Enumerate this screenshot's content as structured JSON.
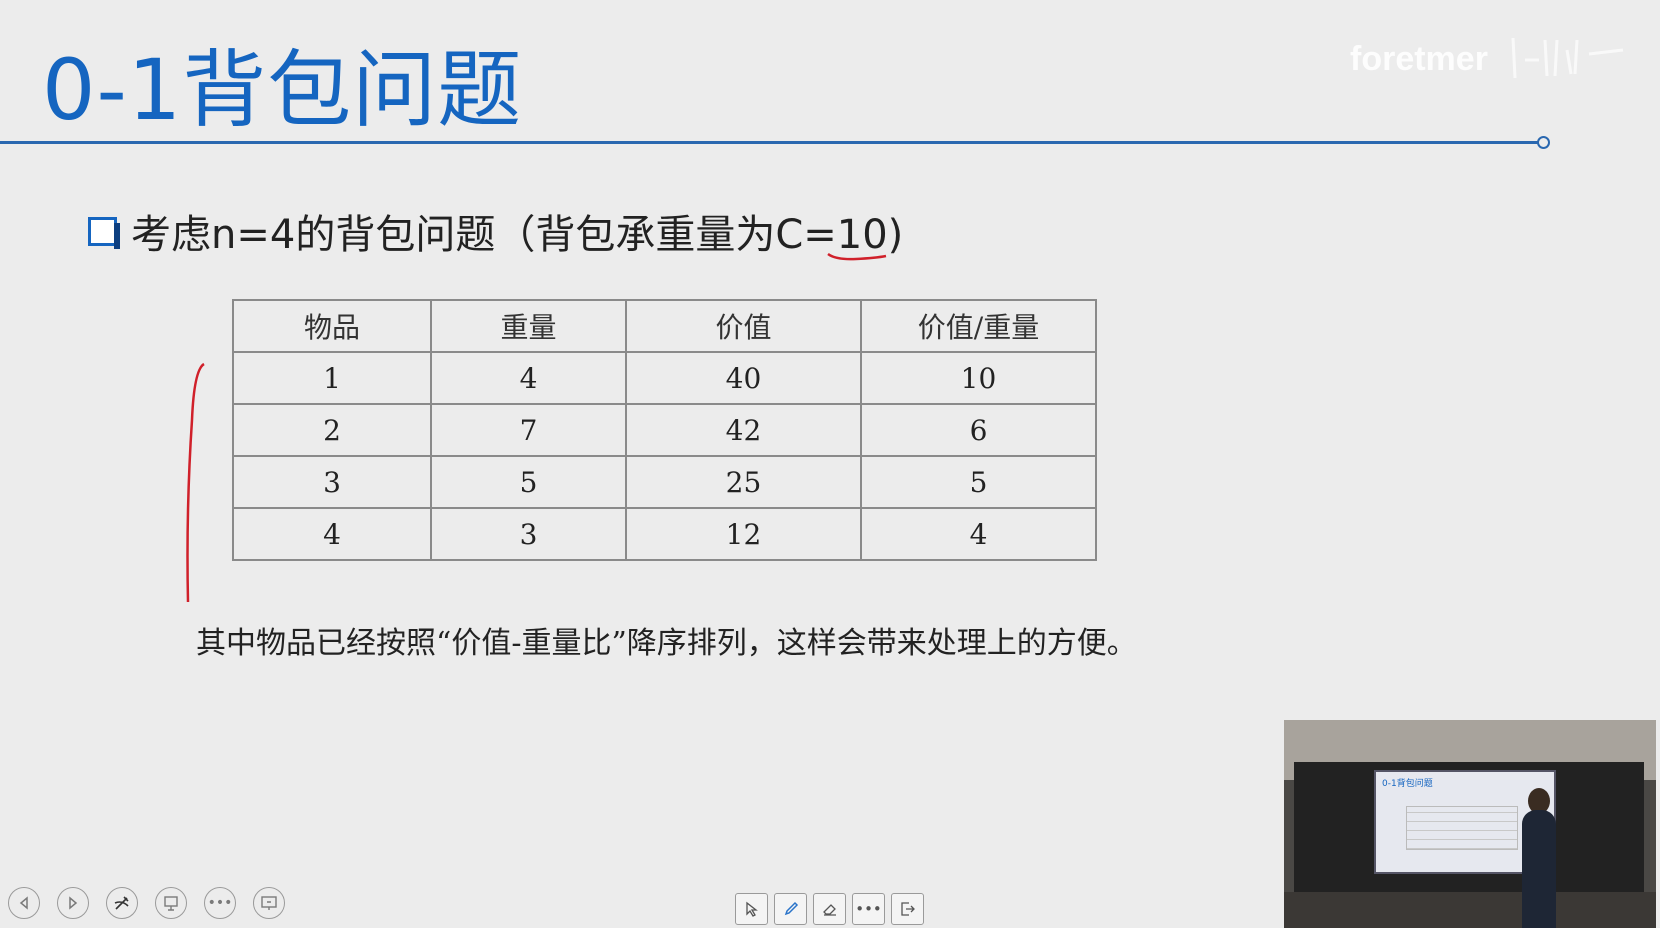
{
  "slide": {
    "title": "0-1背包问题",
    "bullet": "考虑n=4的背包问题（背包承重量为C=10)",
    "note": "其中物品已经按照“价值-重量比”降序排列，这样会带来处理上的方便。"
  },
  "logo": {
    "text": "foretmer"
  },
  "table": {
    "headers": [
      "物品",
      "重量",
      "价值",
      "价值/重量"
    ],
    "rows": [
      [
        "1",
        "4",
        "40",
        "10"
      ],
      [
        "2",
        "7",
        "42",
        "6"
      ],
      [
        "3",
        "5",
        "25",
        "5"
      ],
      [
        "4",
        "3",
        "12",
        "4"
      ]
    ]
  },
  "video": {
    "screen_title": "0-1背包问题"
  },
  "nav": {
    "left_buttons": [
      "prev-icon",
      "next-icon",
      "pen-icon",
      "pointer-icon",
      "more-icon",
      "screen-icon"
    ],
    "center_tools": [
      "arrow-icon",
      "pencil-icon",
      "eraser-icon",
      "more-icon",
      "exit-icon"
    ],
    "more_glyph": "•••"
  },
  "colors": {
    "accent": "#1565c0",
    "annotation": "#d0202a"
  }
}
